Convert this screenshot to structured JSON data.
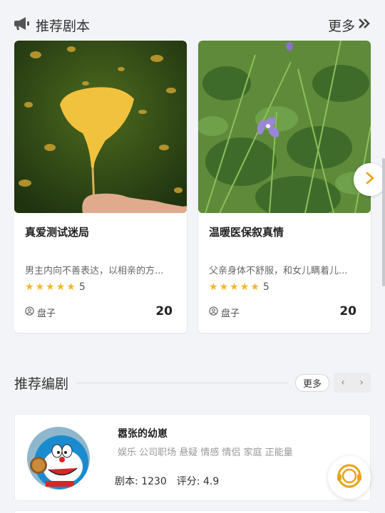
{
  "recommend_scripts": {
    "title": "推荐剧本",
    "more_label": "更多",
    "items": [
      {
        "name": "真爱测试迷局",
        "description": "男主内向不善表达，以相亲的方...",
        "rating": "5",
        "author": "盘子",
        "count": "20"
      },
      {
        "name": "温暖医保叙真情",
        "description": "父亲身体不舒服，和女儿瞒着儿...",
        "rating": "5",
        "author": "盘子",
        "count": "20"
      }
    ]
  },
  "recommend_writers": {
    "title": "推荐编剧",
    "more_label": "更多",
    "items": [
      {
        "name": "嚣张的幼崽",
        "tags": "娱乐 公司职场 悬疑 情感 情侣 家庭 正能量",
        "scripts_label": "剧本: 1230",
        "score_label": "评分: 4.9"
      }
    ]
  },
  "colors": {
    "star": "#f7b52c",
    "accent": "#e8a317"
  }
}
